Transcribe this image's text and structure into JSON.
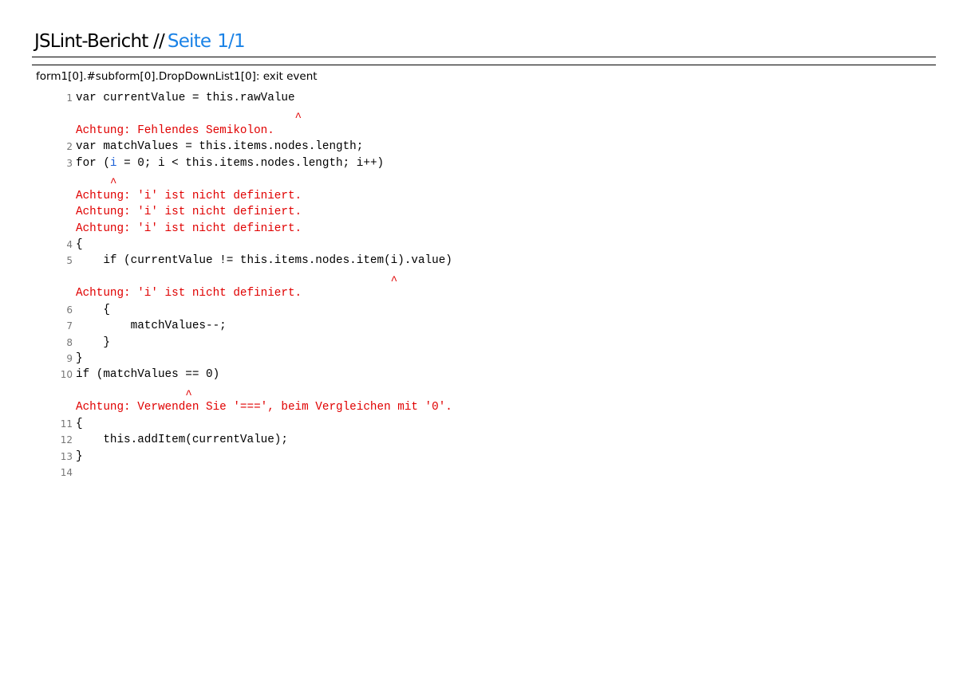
{
  "header": {
    "title": "JSLint-Bericht",
    "separator": "//",
    "page_label": "Seite",
    "page_number": "1/1"
  },
  "section": {
    "title": "form1[0].#subform[0].DropDownList1[0]: exit event"
  },
  "rows": [
    {
      "type": "code",
      "num": "1",
      "text": "var currentValue = this.rawValue"
    },
    {
      "type": "caret",
      "text": "                                ^"
    },
    {
      "type": "error",
      "text": "Achtung: Fehlendes Semikolon."
    },
    {
      "type": "code",
      "num": "2",
      "text": "var matchValues = this.items.nodes.length;"
    },
    {
      "type": "code",
      "num": "3",
      "pre": "for (",
      "hl": "i",
      "text": " = 0; i < this.items.nodes.length; i++)"
    },
    {
      "type": "caret",
      "text": "     ^"
    },
    {
      "type": "error",
      "text": "Achtung: 'i' ist nicht definiert."
    },
    {
      "type": "error",
      "text": "Achtung: 'i' ist nicht definiert."
    },
    {
      "type": "error",
      "text": "Achtung: 'i' ist nicht definiert."
    },
    {
      "type": "code",
      "num": "4",
      "text": "{"
    },
    {
      "type": "code",
      "num": "5",
      "text": "    if (currentValue != this.items.nodes.item(i).value)"
    },
    {
      "type": "caret",
      "text": "                                              ^"
    },
    {
      "type": "error",
      "text": "Achtung: 'i' ist nicht definiert."
    },
    {
      "type": "code",
      "num": "6",
      "text": "    {"
    },
    {
      "type": "code",
      "num": "7",
      "text": "        matchValues--;"
    },
    {
      "type": "code",
      "num": "8",
      "text": "    }"
    },
    {
      "type": "code",
      "num": "9",
      "text": "}"
    },
    {
      "type": "code",
      "num": "10",
      "text": "if (matchValues == 0)"
    },
    {
      "type": "caret",
      "text": "                ^"
    },
    {
      "type": "error",
      "text": "Achtung: Verwenden Sie '===', beim Vergleichen mit '0'."
    },
    {
      "type": "code",
      "num": "11",
      "text": "{"
    },
    {
      "type": "code",
      "num": "12",
      "text": "    this.addItem(currentValue);"
    },
    {
      "type": "code",
      "num": "13",
      "text": "}"
    },
    {
      "type": "code",
      "num": "14",
      "text": ""
    }
  ]
}
